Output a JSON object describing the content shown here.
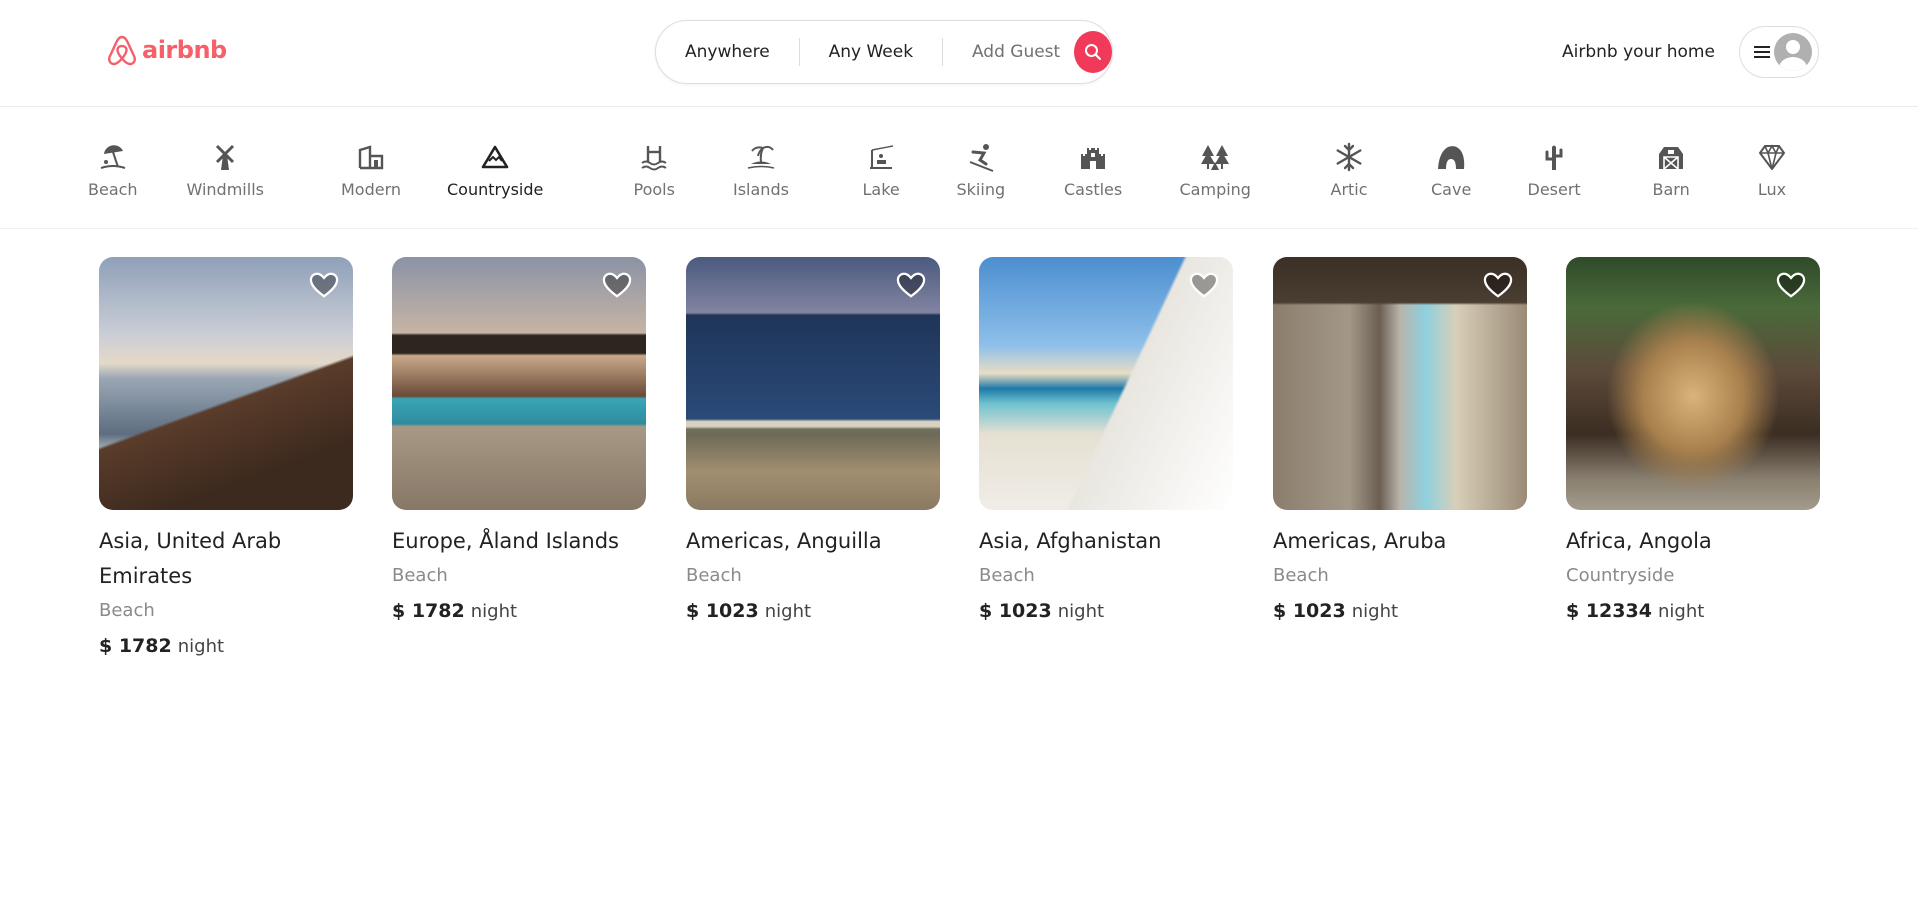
{
  "header": {
    "logo_text": "airbnb",
    "search": {
      "where": "Anywhere",
      "when": "Any Week",
      "who": "Add Guest"
    },
    "host_link": "Airbnb your home"
  },
  "categories": [
    {
      "label": "Beach",
      "icon": "beach-umbrella-icon"
    },
    {
      "label": "Windmills",
      "icon": "windmill-icon"
    },
    {
      "label": "Modern",
      "icon": "modern-house-icon"
    },
    {
      "label": "Countryside",
      "icon": "mountain-icon",
      "active": true
    },
    {
      "label": "Pools",
      "icon": "pool-icon"
    },
    {
      "label": "Islands",
      "icon": "island-icon"
    },
    {
      "label": "Lake",
      "icon": "lake-fishing-icon"
    },
    {
      "label": "Skiing",
      "icon": "skier-icon"
    },
    {
      "label": "Castles",
      "icon": "castle-icon"
    },
    {
      "label": "Camping",
      "icon": "camping-trees-icon"
    },
    {
      "label": "Artic",
      "icon": "snowflake-icon"
    },
    {
      "label": "Cave",
      "icon": "cave-icon"
    },
    {
      "label": "Desert",
      "icon": "cactus-icon"
    },
    {
      "label": "Barn",
      "icon": "barn-icon"
    },
    {
      "label": "Lux",
      "icon": "diamond-icon"
    }
  ],
  "listings": [
    {
      "location": "Asia, United Arab Emirates",
      "category": "Beach",
      "price": "$ 1782",
      "unit": "night"
    },
    {
      "location": "Europe, Åland Islands",
      "category": "Beach",
      "price": "$ 1782",
      "unit": "night"
    },
    {
      "location": "Americas, Anguilla",
      "category": "Beach",
      "price": "$ 1023",
      "unit": "night"
    },
    {
      "location": "Asia, Afghanistan",
      "category": "Beach",
      "price": "$ 1023",
      "unit": "night"
    },
    {
      "location": "Americas, Aruba",
      "category": "Beach",
      "price": "$ 1023",
      "unit": "night"
    },
    {
      "location": "Africa, Angola",
      "category": "Countryside",
      "price": "$ 12334",
      "unit": "night"
    }
  ],
  "colors": {
    "brand": "#f5606a",
    "search_button": "#f1395a",
    "muted_text": "#717171"
  }
}
